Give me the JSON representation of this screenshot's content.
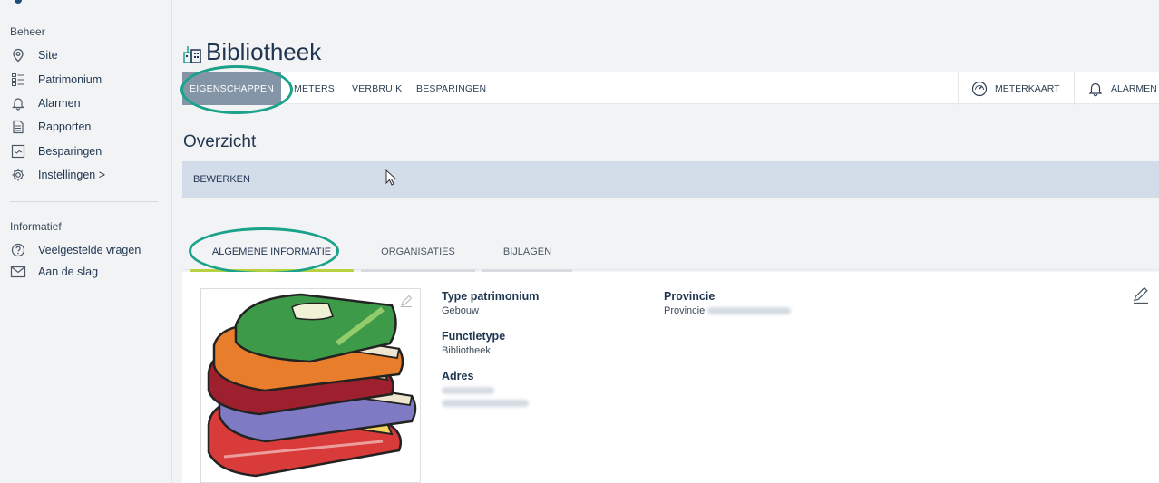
{
  "sidebar": {
    "section_beheer": "Beheer",
    "items": [
      {
        "label": "Site",
        "icon": "location-pin-icon"
      },
      {
        "label": "Patrimonium",
        "icon": "list-icon"
      },
      {
        "label": "Alarmen",
        "icon": "bell-icon"
      },
      {
        "label": "Rapporten",
        "icon": "document-icon"
      },
      {
        "label": "Besparingen",
        "icon": "savings-icon"
      },
      {
        "label": "Instellingen >",
        "icon": "gear-icon"
      }
    ],
    "section_info": "Informatief",
    "info_items": [
      {
        "label": "Veelgestelde vragen",
        "icon": "question-icon"
      },
      {
        "label": "Aan de slag",
        "icon": "mail-icon"
      }
    ]
  },
  "page": {
    "title": "Bibliotheek",
    "title_icon": "building-icon"
  },
  "topbar": {
    "tabs": [
      "EIGENSCHAPPEN",
      "METERS",
      "VERBRUIK",
      "BESPARINGEN"
    ],
    "meterkaart": "METERKAART",
    "alarmen": "ALARMEN"
  },
  "overview": {
    "title": "Overzicht",
    "edit": "BEWERKEN"
  },
  "subtabs": [
    "ALGEMENE INFORMATIE",
    "ORGANISATIES",
    "BIJLAGEN"
  ],
  "details": {
    "type_label": "Type patrimonium",
    "type_value": "Gebouw",
    "functie_label": "Functietype",
    "functie_value": "Bibliotheek",
    "adres_label": "Adres",
    "provincie_label": "Provincie",
    "provincie_value": "Provincie"
  },
  "colors": {
    "accent": "#1aa38a",
    "active_tab": "#8395a7",
    "editbar": "#d3dde9",
    "subtab_underline": "#b7d13f"
  }
}
